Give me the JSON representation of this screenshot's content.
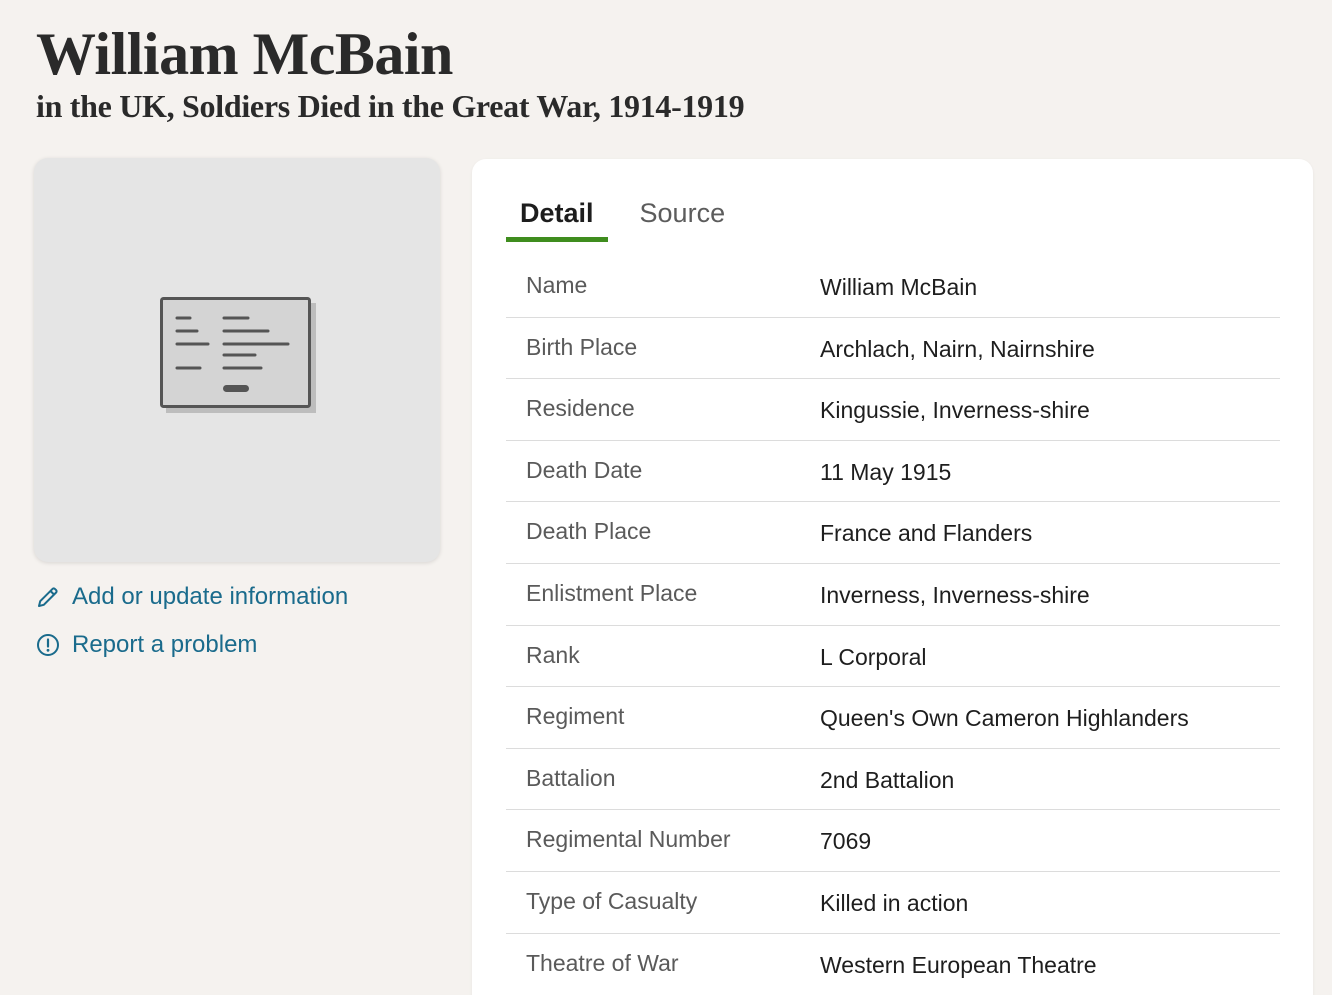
{
  "header": {
    "title": "William McBain",
    "subtitle": "in the UK, Soldiers Died in the Great War, 1914-1919"
  },
  "record_image": {
    "icon": "document-record-icon"
  },
  "actions": {
    "add_update_label": "Add or update information",
    "report_label": "Report a problem",
    "link_color": "#1a6b8c"
  },
  "tabs": [
    {
      "label": "Detail",
      "active": true
    },
    {
      "label": "Source",
      "active": false
    }
  ],
  "accent_color": "#3f8d1e",
  "facts": [
    {
      "label": "Name",
      "value": "William McBain"
    },
    {
      "label": "Birth Place",
      "value": "Archlach, Nairn, Nairnshire"
    },
    {
      "label": "Residence",
      "value": "Kingussie, Inverness-shire"
    },
    {
      "label": "Death Date",
      "value": "11 May 1915"
    },
    {
      "label": "Death Place",
      "value": "France and Flanders"
    },
    {
      "label": "Enlistment Place",
      "value": "Inverness, Inverness-shire"
    },
    {
      "label": "Rank",
      "value": "L Corporal"
    },
    {
      "label": "Regiment",
      "value": "Queen's Own Cameron Highlanders"
    },
    {
      "label": "Battalion",
      "value": "2nd Battalion"
    },
    {
      "label": "Regimental Number",
      "value": "7069"
    },
    {
      "label": "Type of Casualty",
      "value": "Killed in action"
    },
    {
      "label": "Theatre of War",
      "value": "Western European Theatre"
    }
  ]
}
